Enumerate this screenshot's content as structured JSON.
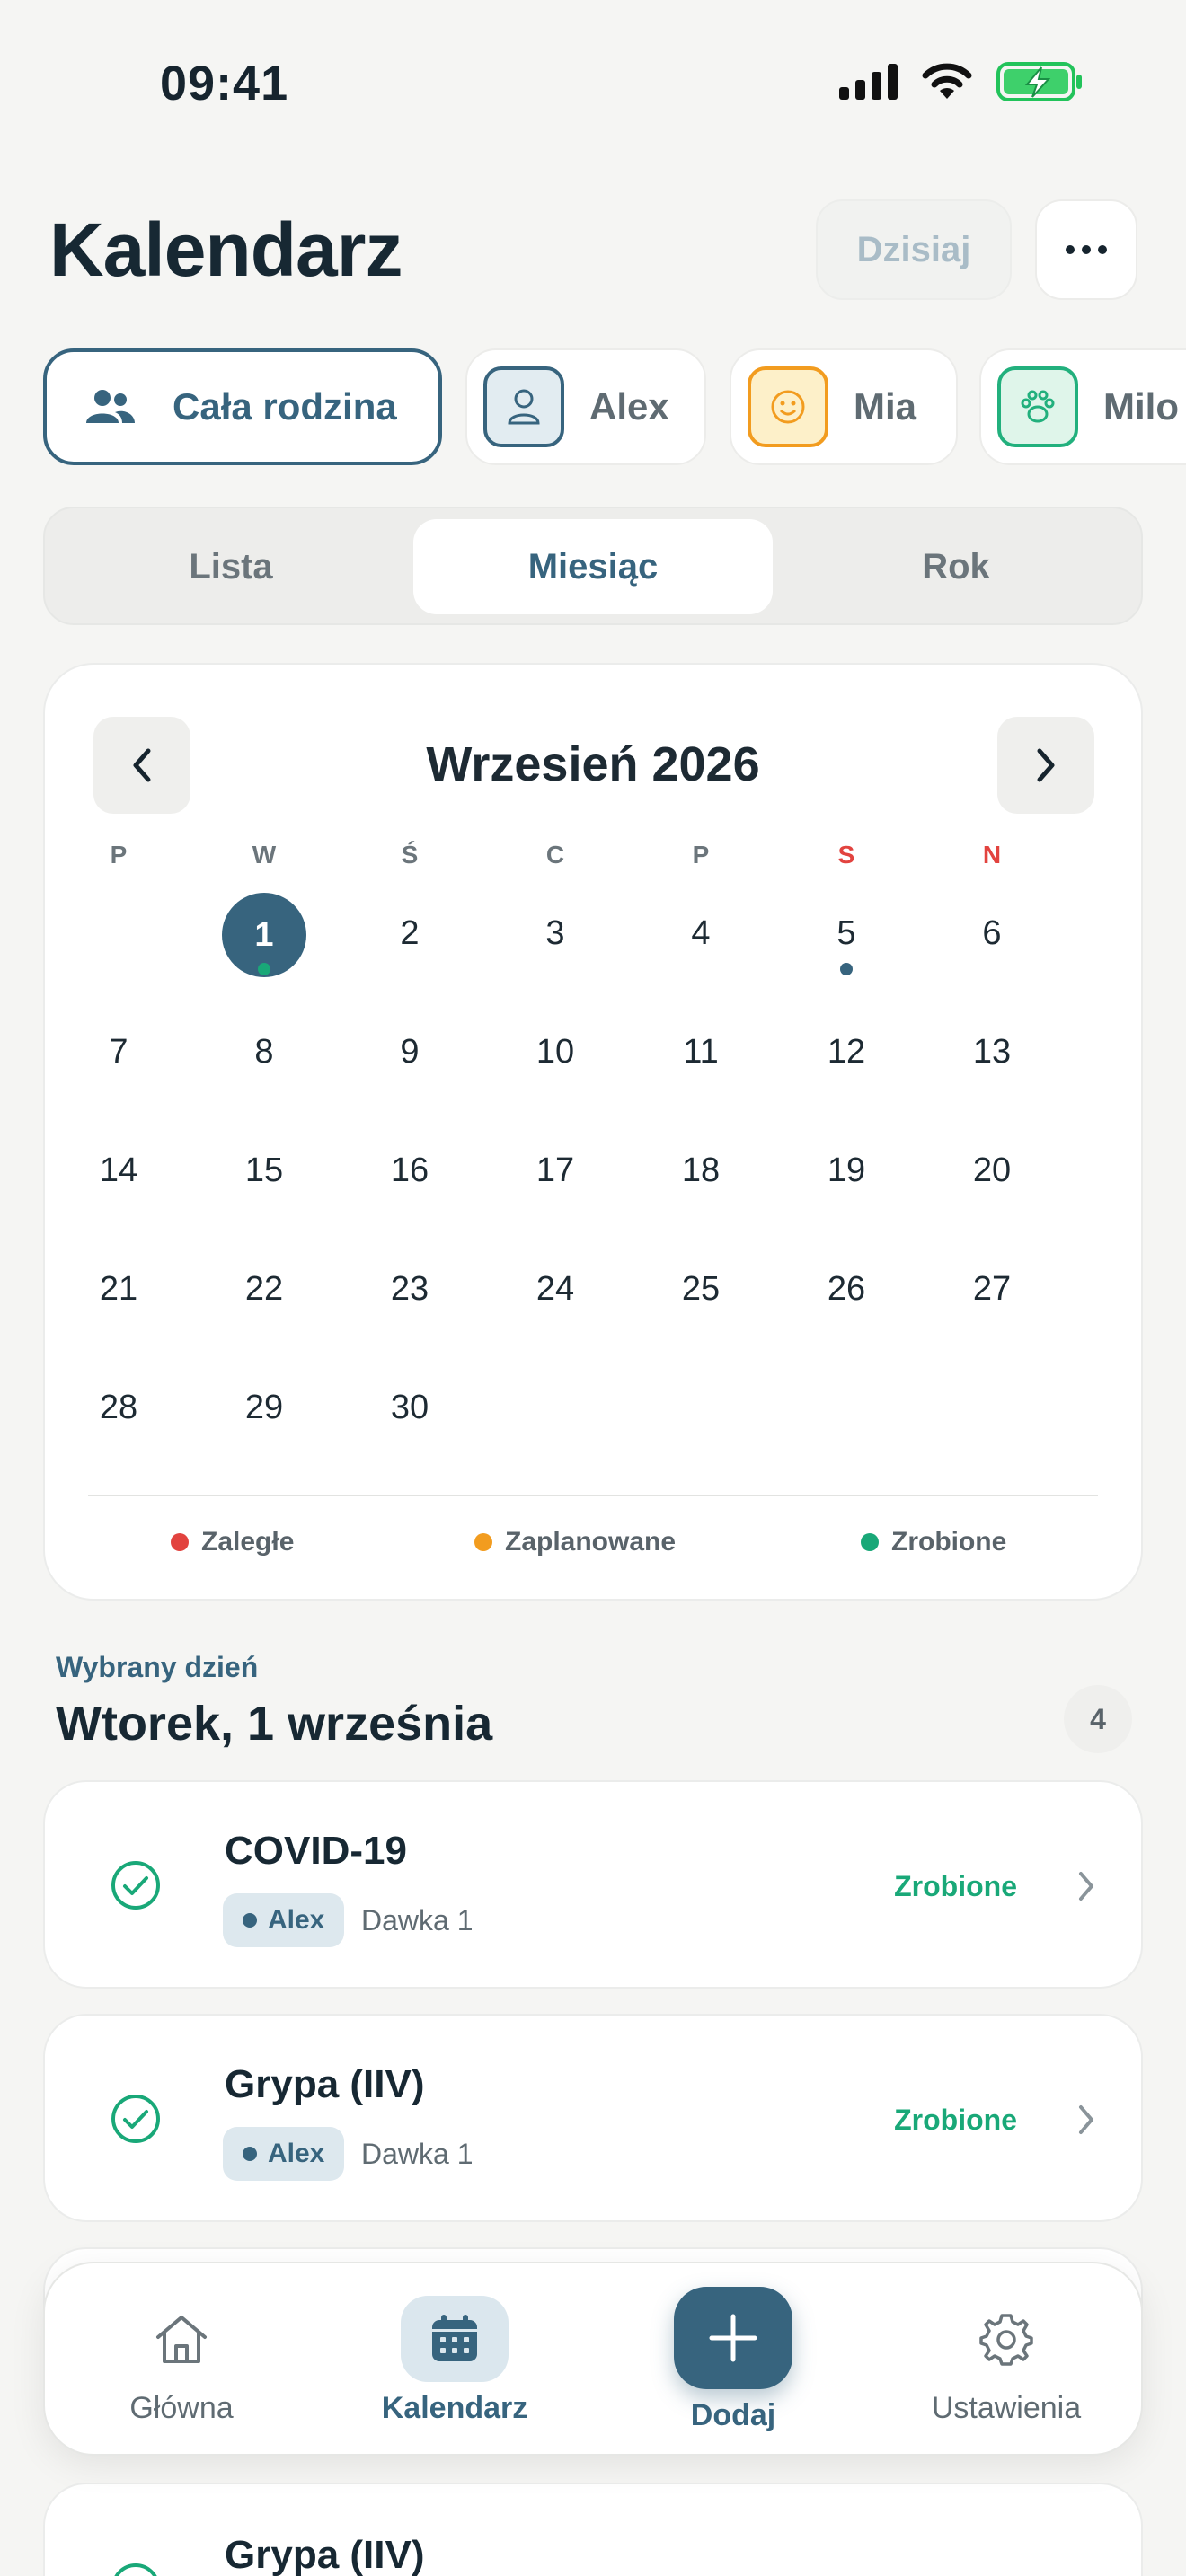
{
  "status_bar": {
    "time": "09:41"
  },
  "header": {
    "title": "Kalendarz",
    "today_label": "Dzisiaj"
  },
  "profiles": [
    {
      "label": "Cała rodzina",
      "icon": "family-icon",
      "active": true
    },
    {
      "label": "Alex",
      "icon": "person-icon",
      "color": "#37647e"
    },
    {
      "label": "Mia",
      "icon": "smiley-icon",
      "color": "#f29c1f"
    },
    {
      "label": "Milo",
      "icon": "paw-icon",
      "color": "#22b07d"
    }
  ],
  "view_tabs": [
    {
      "label": "Lista"
    },
    {
      "label": "Miesiąc",
      "active": true
    },
    {
      "label": "Rok"
    }
  ],
  "calendar": {
    "month_title": "Wrzesień 2026",
    "weekdays": [
      "P",
      "W",
      "Ś",
      "C",
      "P",
      "S",
      "N"
    ],
    "first_weekday_index": 1,
    "days_in_month": 30,
    "selected_day": 1,
    "event_dots": [
      {
        "day": 1,
        "status": "done"
      },
      {
        "day": 5,
        "status": "scheduled"
      }
    ],
    "legend": [
      {
        "label": "Zaległe",
        "color": "#e2433f"
      },
      {
        "label": "Zaplanowane",
        "color": "#f29c1f"
      },
      {
        "label": "Zrobione",
        "color": "#19a878"
      }
    ]
  },
  "selected_day": {
    "label": "Wybrany dzień",
    "title": "Wtorek, 1 września",
    "count": "4"
  },
  "events": [
    {
      "title": "COVID-19",
      "person": "Alex",
      "dose": "Dawka 1",
      "status": "Zrobione"
    },
    {
      "title": "Grypa (IIV)",
      "person": "Alex",
      "dose": "Dawka 1",
      "status": "Zrobione"
    },
    {
      "title": "",
      "person": "",
      "dose": "",
      "status": ""
    },
    {
      "title": "Grypa (IIV)",
      "person": "",
      "dose": "",
      "status": ""
    }
  ],
  "bottom_nav": {
    "home": "Główna",
    "calendar": "Kalendarz",
    "add": "Dodaj",
    "settings": "Ustawienia"
  },
  "colors": {
    "primary": "#37647e",
    "done": "#19a878",
    "scheduled": "#f29c1f",
    "overdue": "#e2433f"
  }
}
